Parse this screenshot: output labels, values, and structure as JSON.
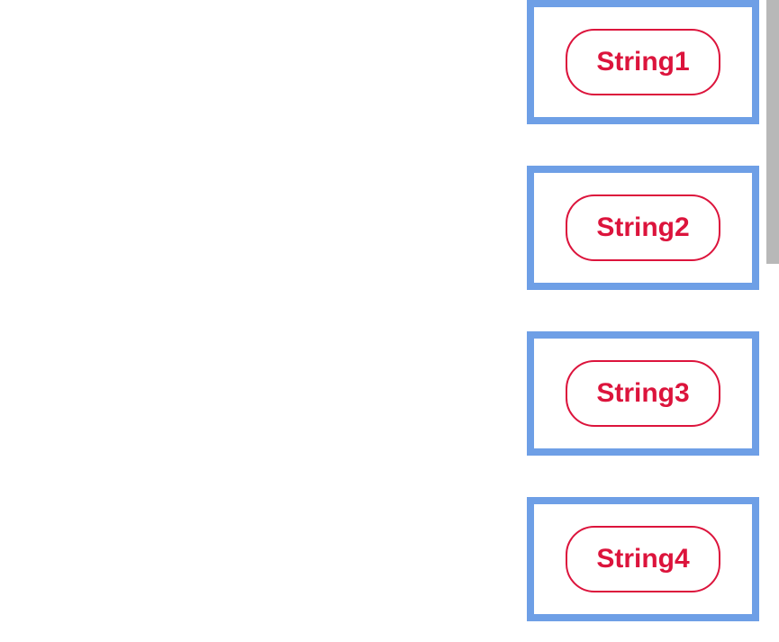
{
  "cards": [
    {
      "label": "String1"
    },
    {
      "label": "String2"
    },
    {
      "label": "String3"
    },
    {
      "label": "String4"
    }
  ],
  "colors": {
    "card_border": "#6e9fe6",
    "pill_border": "#dc143c",
    "pill_text": "#dc143c"
  }
}
